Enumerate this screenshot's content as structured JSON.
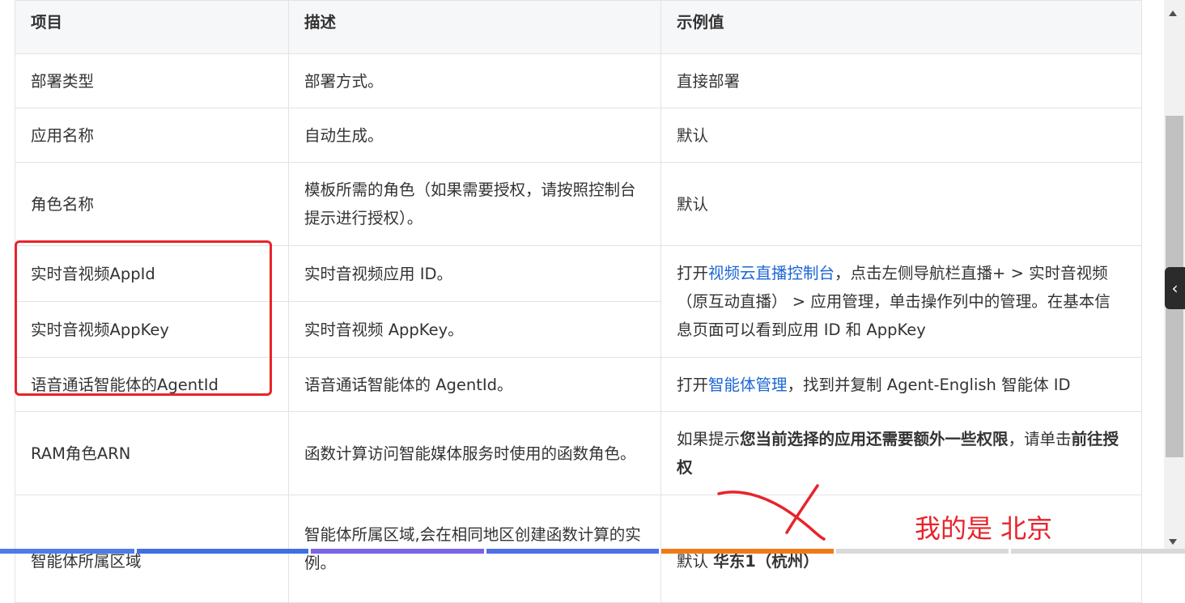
{
  "table": {
    "headers": [
      "项目",
      "描述",
      "示例值"
    ],
    "rows": {
      "deploy_type": {
        "item": "部署类型",
        "desc": "部署方式。",
        "example": "直接部署"
      },
      "app_name": {
        "item": "应用名称",
        "desc": "自动生成。",
        "example": "默认"
      },
      "role_name": {
        "item": "角色名称",
        "desc": "模板所需的角色（如果需要授权，请按照控制台提示进行授权）。",
        "example": "默认"
      },
      "rtc_appid": {
        "item": "实时音视频AppId",
        "desc": "实时音视频应用 ID。"
      },
      "rtc_appkey": {
        "item": "实时音视频AppKey",
        "desc": "实时音视频 AppKey。"
      },
      "rtc_example": {
        "prefix": "打开",
        "link": "视频云直播控制台",
        "suffix": "，点击左侧导航栏直播+ > 实时音视频（原互动直播） > 应用管理，单击操作列中的管理。在基本信息页面可以看到应用 ID 和 AppKey"
      },
      "agent_id": {
        "item": "语音通话智能体的AgentId",
        "desc": "语音通话智能体的 AgentId。",
        "example_prefix": "打开",
        "example_link": "智能体管理",
        "example_suffix": "，找到并复制 Agent-English 智能体 ID"
      },
      "ram_role": {
        "item": "RAM角色ARN",
        "desc": "函数计算访问智能媒体服务时使用的函数角色。",
        "example_prefix": "如果提示",
        "example_bold": "您当前选择的应用还需要额外一些权限",
        "example_mid": "，请单击",
        "example_bold2": "前往授权"
      },
      "region": {
        "item": "智能体所属区域",
        "desc": "智能体所属区域,会在相同地区创建函数计算的实例。",
        "example_prefix": "默认 ",
        "example_bold": "华东1（杭州）"
      }
    }
  },
  "annotation": {
    "note": "我的是 北京",
    "color": "#e8232a"
  },
  "side_toggle": {
    "icon": "chevron-left-icon",
    "glyph": "‹"
  },
  "colors": {
    "link": "#1a66d5",
    "header_bg": "#f6f7f9",
    "border": "#e3e3e3",
    "annotation": "#e8232a"
  }
}
